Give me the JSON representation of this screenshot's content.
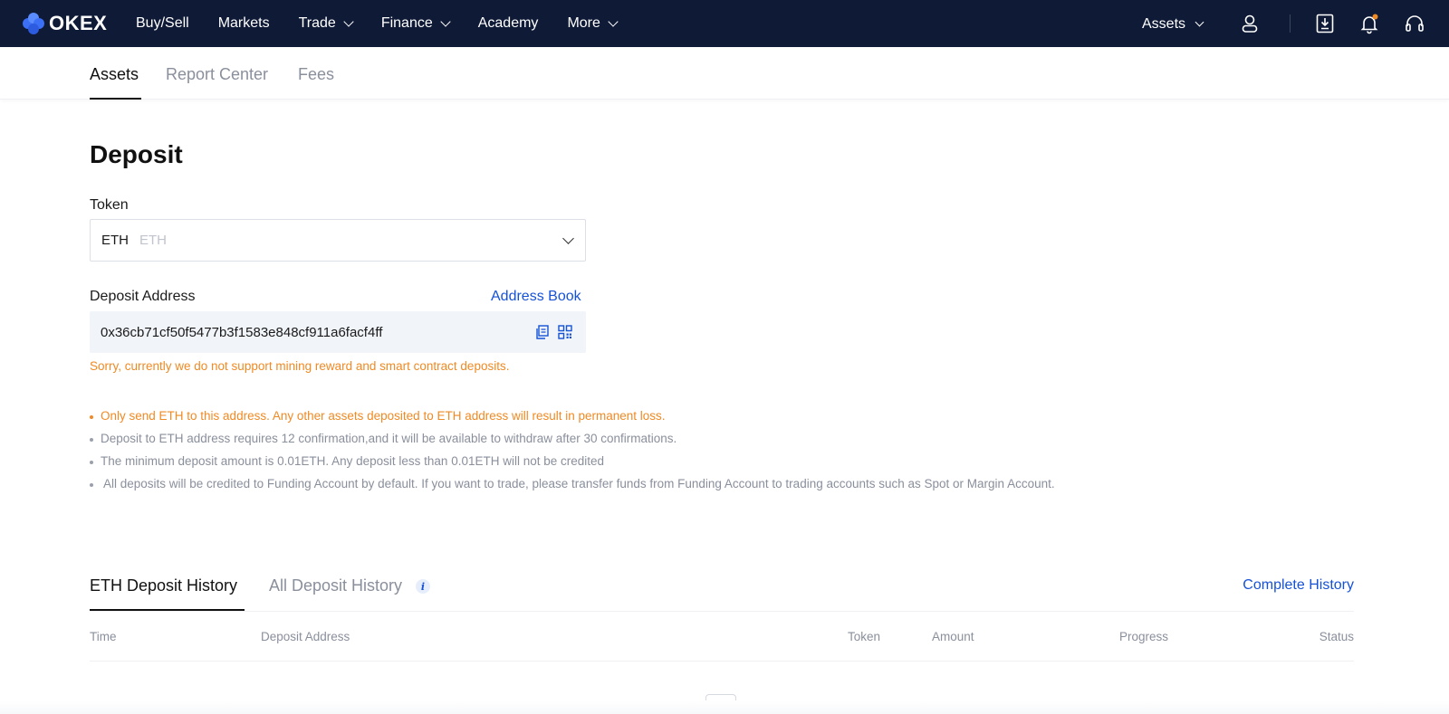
{
  "brand": {
    "name": "OKEX",
    "accent": "#1552d6",
    "navbar_bg": "#0f1a36",
    "warning_color": "#f08a24"
  },
  "nav": {
    "items": [
      {
        "label": "Buy/Sell",
        "has_dropdown": false
      },
      {
        "label": "Markets",
        "has_dropdown": false
      },
      {
        "label": "Trade",
        "has_dropdown": true
      },
      {
        "label": "Finance",
        "has_dropdown": true
      },
      {
        "label": "Academy",
        "has_dropdown": false
      },
      {
        "label": "More",
        "has_dropdown": true
      }
    ],
    "assets_label": "Assets",
    "icons": [
      "user-icon",
      "download-icon",
      "bell-icon",
      "headset-icon"
    ]
  },
  "subtabs": {
    "items": [
      {
        "label": "Assets",
        "active": true
      },
      {
        "label": "Report Center",
        "active": false
      },
      {
        "label": "Fees",
        "active": false
      }
    ]
  },
  "deposit": {
    "title": "Deposit",
    "token_label": "Token",
    "token_value": "ETH",
    "token_sub": "ETH",
    "address_label": "Deposit Address",
    "address_book_label": "Address Book",
    "address": "0x36cb71cf50f5477b3f1583e848cf911a6facf4ff",
    "warning": "Sorry, currently we do not support mining reward and smart contract deposits.",
    "notes": [
      {
        "text": "Only send ETH to this address. Any other assets deposited to ETH address will result in permanent loss.",
        "highlight": true
      },
      {
        "text": "Deposit to ETH address requires 12 confirmation,and it will be available to withdraw after 30 confirmations.",
        "highlight": false
      },
      {
        "text": "The minimum deposit amount is 0.01ETH. Any deposit less than 0.01ETH will not be credited",
        "highlight": false
      },
      {
        "text": " All deposits will be credited to Funding Account by default. If you want to trade, please transfer funds from Funding Account to trading accounts such as Spot or Margin Account.",
        "highlight": false
      }
    ]
  },
  "history": {
    "tabs": [
      {
        "label": "ETH Deposit History",
        "active": true
      },
      {
        "label": "All Deposit History",
        "active": false
      }
    ],
    "complete_history_label": "Complete History",
    "columns": [
      "Time",
      "Deposit Address",
      "Token",
      "Amount",
      "Progress",
      "Status"
    ]
  }
}
